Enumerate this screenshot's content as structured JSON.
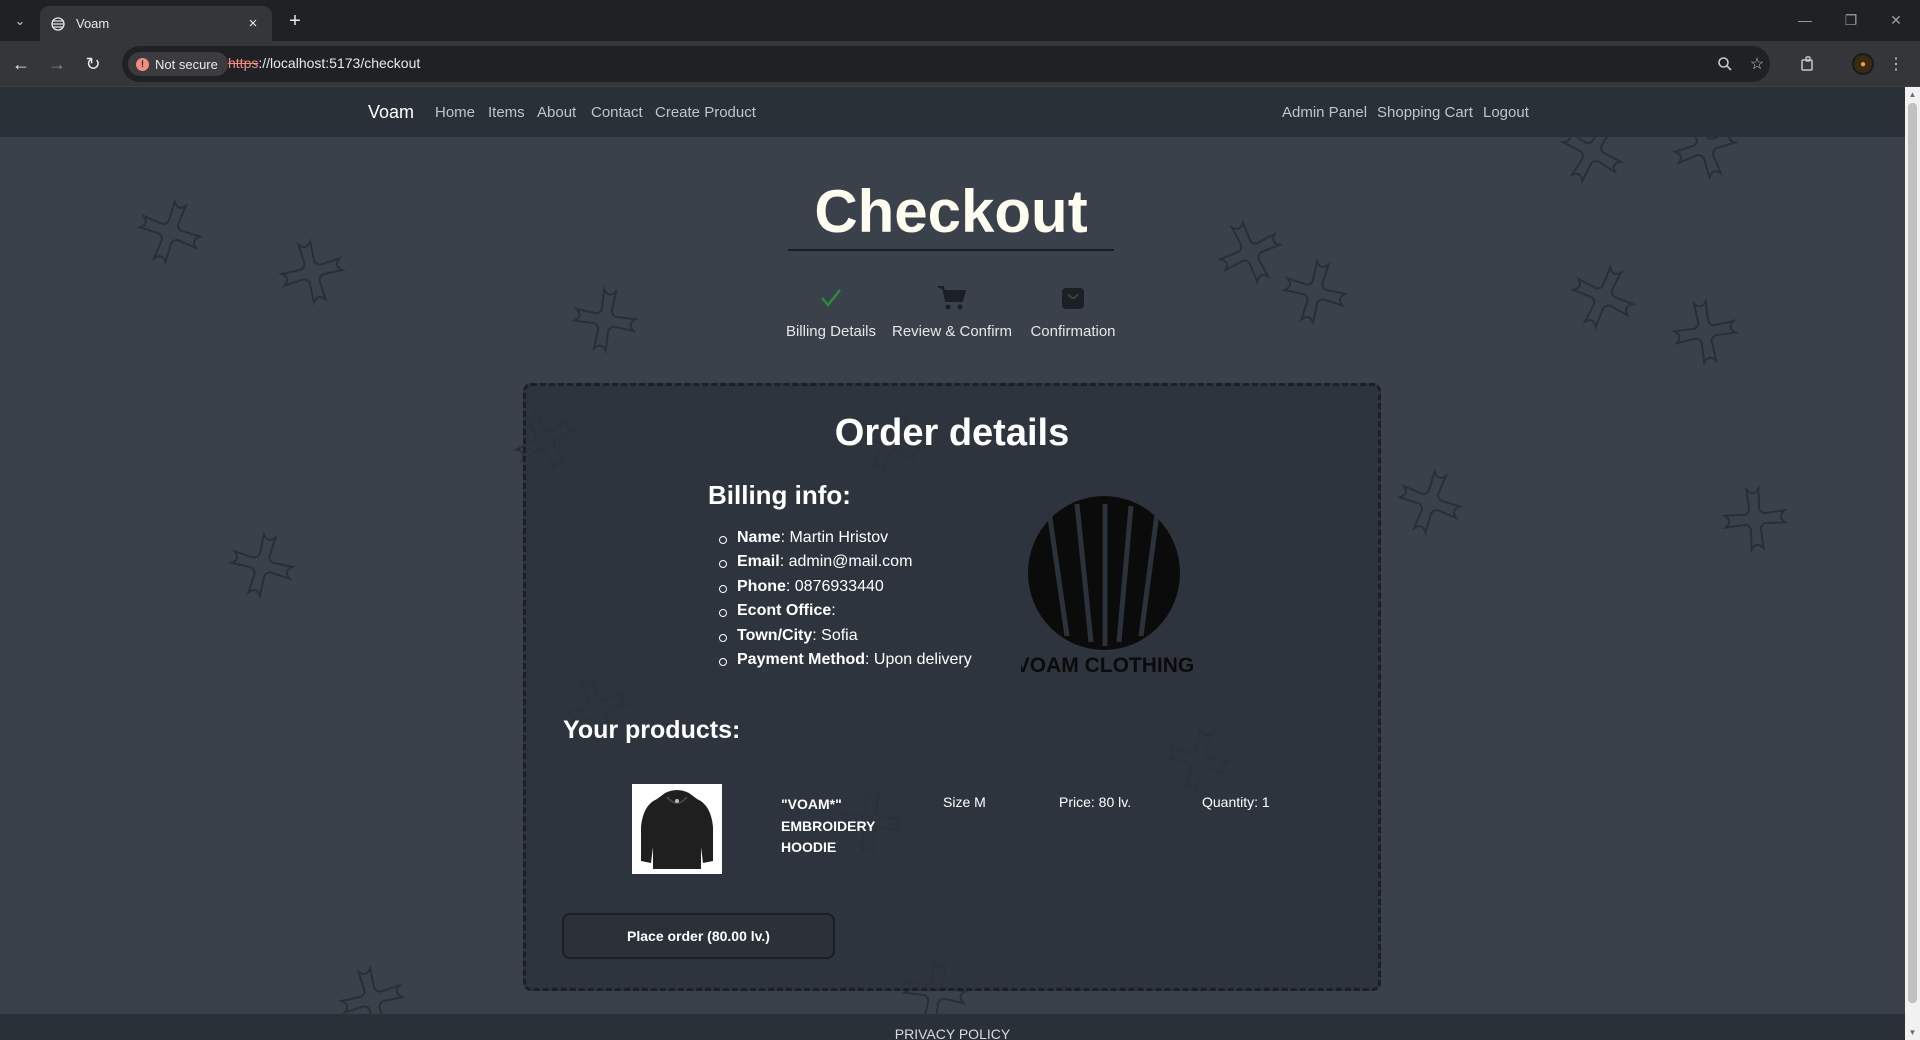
{
  "browser": {
    "tab_title": "Voam",
    "security_label": "Not secure",
    "url_scheme": "https",
    "url_rest": "://localhost:5173/checkout"
  },
  "nav": {
    "brand": "Voam",
    "left_links": [
      "Home",
      "Items",
      "About",
      "Contact",
      "Create Product"
    ],
    "right_links": [
      "Admin Panel",
      "Shopping Cart",
      "Logout"
    ]
  },
  "checkout": {
    "title": "Checkout",
    "steps": [
      {
        "label": "Billing Details",
        "icon": "check-icon",
        "color": "#2e8b3a"
      },
      {
        "label": "Review & Confirm",
        "icon": "cart-icon"
      },
      {
        "label": "Confirmation",
        "icon": "shopping-bag-icon"
      }
    ]
  },
  "order": {
    "title": "Order details",
    "billing_title": "Billing info:",
    "billing": [
      {
        "label": "Name",
        "value": ": Martin Hristov"
      },
      {
        "label": "Email",
        "value": ": admin@mail.com"
      },
      {
        "label": "Phone",
        "value": ": 0876933440"
      },
      {
        "label": "Econt Office",
        "value": ":"
      },
      {
        "label": "Town/City",
        "value": ": Sofia"
      },
      {
        "label": "Payment Method",
        "value": ": Upon delivery"
      }
    ],
    "logo_text": "VOAM CLOTHING",
    "products_title": "Your products:",
    "products": [
      {
        "name": "\"VOAM*\" EMBROIDERY HOODIE",
        "size": "Size M",
        "price": "Price: 80 lv.",
        "quantity": "Quantity: 1"
      }
    ],
    "place_order_label": "Place order (80.00 lv.)"
  },
  "footer": {
    "privacy_label": "PRIVACY POLICY"
  },
  "colors": {
    "page_bg": "#3a414b",
    "navbar_bg": "#2a3038",
    "accent_check": "#2e8b3a"
  }
}
